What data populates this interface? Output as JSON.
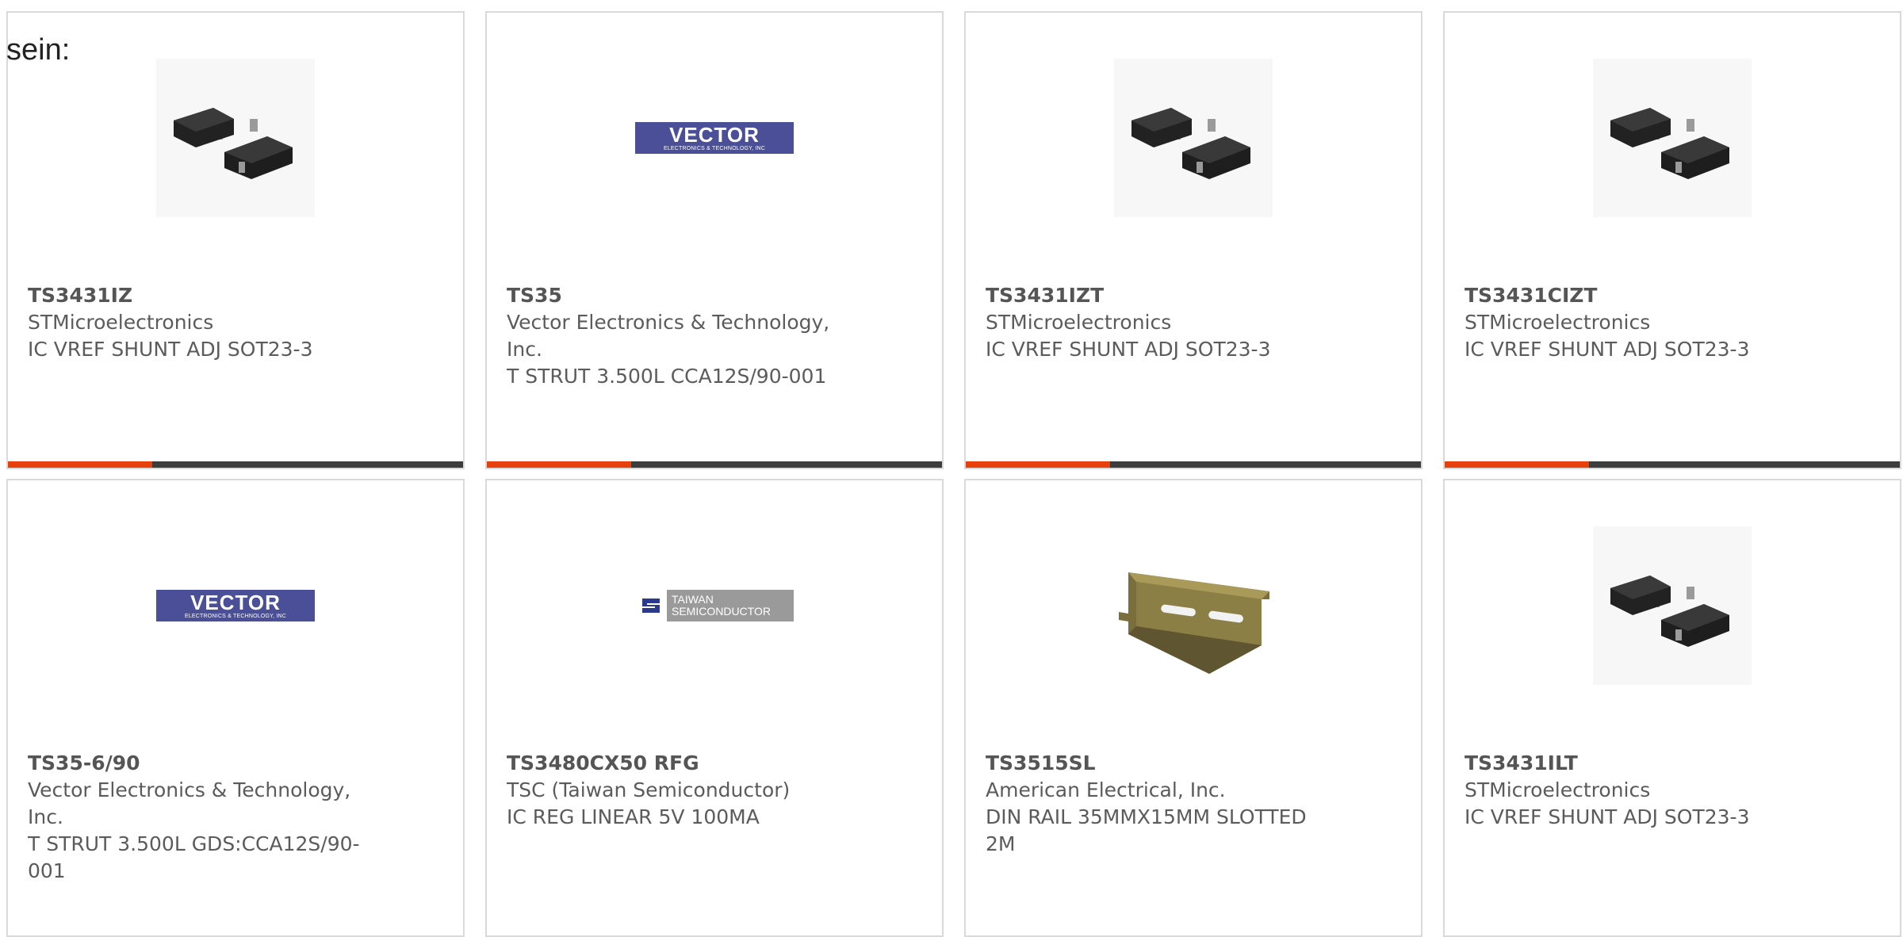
{
  "intro_text": "sein:",
  "colors": {
    "accent": "#e8400c",
    "bar": "#3c3c3c",
    "card_border": "#d9d9d9",
    "vector_blue": "#4a4f98",
    "tsc_gray": "#9a9a9a"
  },
  "logos": {
    "vector": {
      "name": "VECTOR",
      "sub": "ELECTRONICS & TECHNOLOGY, INC"
    },
    "tsc": {
      "line1": "TAIWAN",
      "line2": "SEMICONDUCTOR"
    }
  },
  "products": [
    {
      "part": "TS3431IZ",
      "manufacturer": "STMicroelectronics",
      "description": "IC VREF SHUNT ADJ SOT23-3",
      "image": "sot23-chip-icon"
    },
    {
      "part": "TS35",
      "manufacturer": "Vector Electronics & Technology, Inc.",
      "description": "T STRUT 3.500L CCA12S/90-001",
      "image": "vector-logo"
    },
    {
      "part": "TS3431IZT",
      "manufacturer": "STMicroelectronics",
      "description": "IC VREF SHUNT ADJ SOT23-3",
      "image": "sot23-chip-icon"
    },
    {
      "part": "TS3431CIZT",
      "manufacturer": "STMicroelectronics",
      "description": "IC VREF SHUNT ADJ SOT23-3",
      "image": "sot23-chip-icon"
    },
    {
      "part": "TS35-6/90",
      "manufacturer": "Vector Electronics & Technology, Inc.",
      "description": "T STRUT 3.500L GDS:CCA12S/90-001",
      "image": "vector-logo"
    },
    {
      "part": "TS3480CX50 RFG",
      "manufacturer": "TSC (Taiwan Semiconductor)",
      "description": "IC REG LINEAR 5V 100MA",
      "image": "tsc-logo"
    },
    {
      "part": "TS3515SL",
      "manufacturer": "American Electrical, Inc.",
      "description": "DIN RAIL 35MMX15MM SLOTTED 2M",
      "image": "din-rail-icon"
    },
    {
      "part": "TS3431ILT",
      "manufacturer": "STMicroelectronics",
      "description": "IC VREF SHUNT ADJ SOT23-3",
      "image": "sot23-chip-icon"
    }
  ]
}
